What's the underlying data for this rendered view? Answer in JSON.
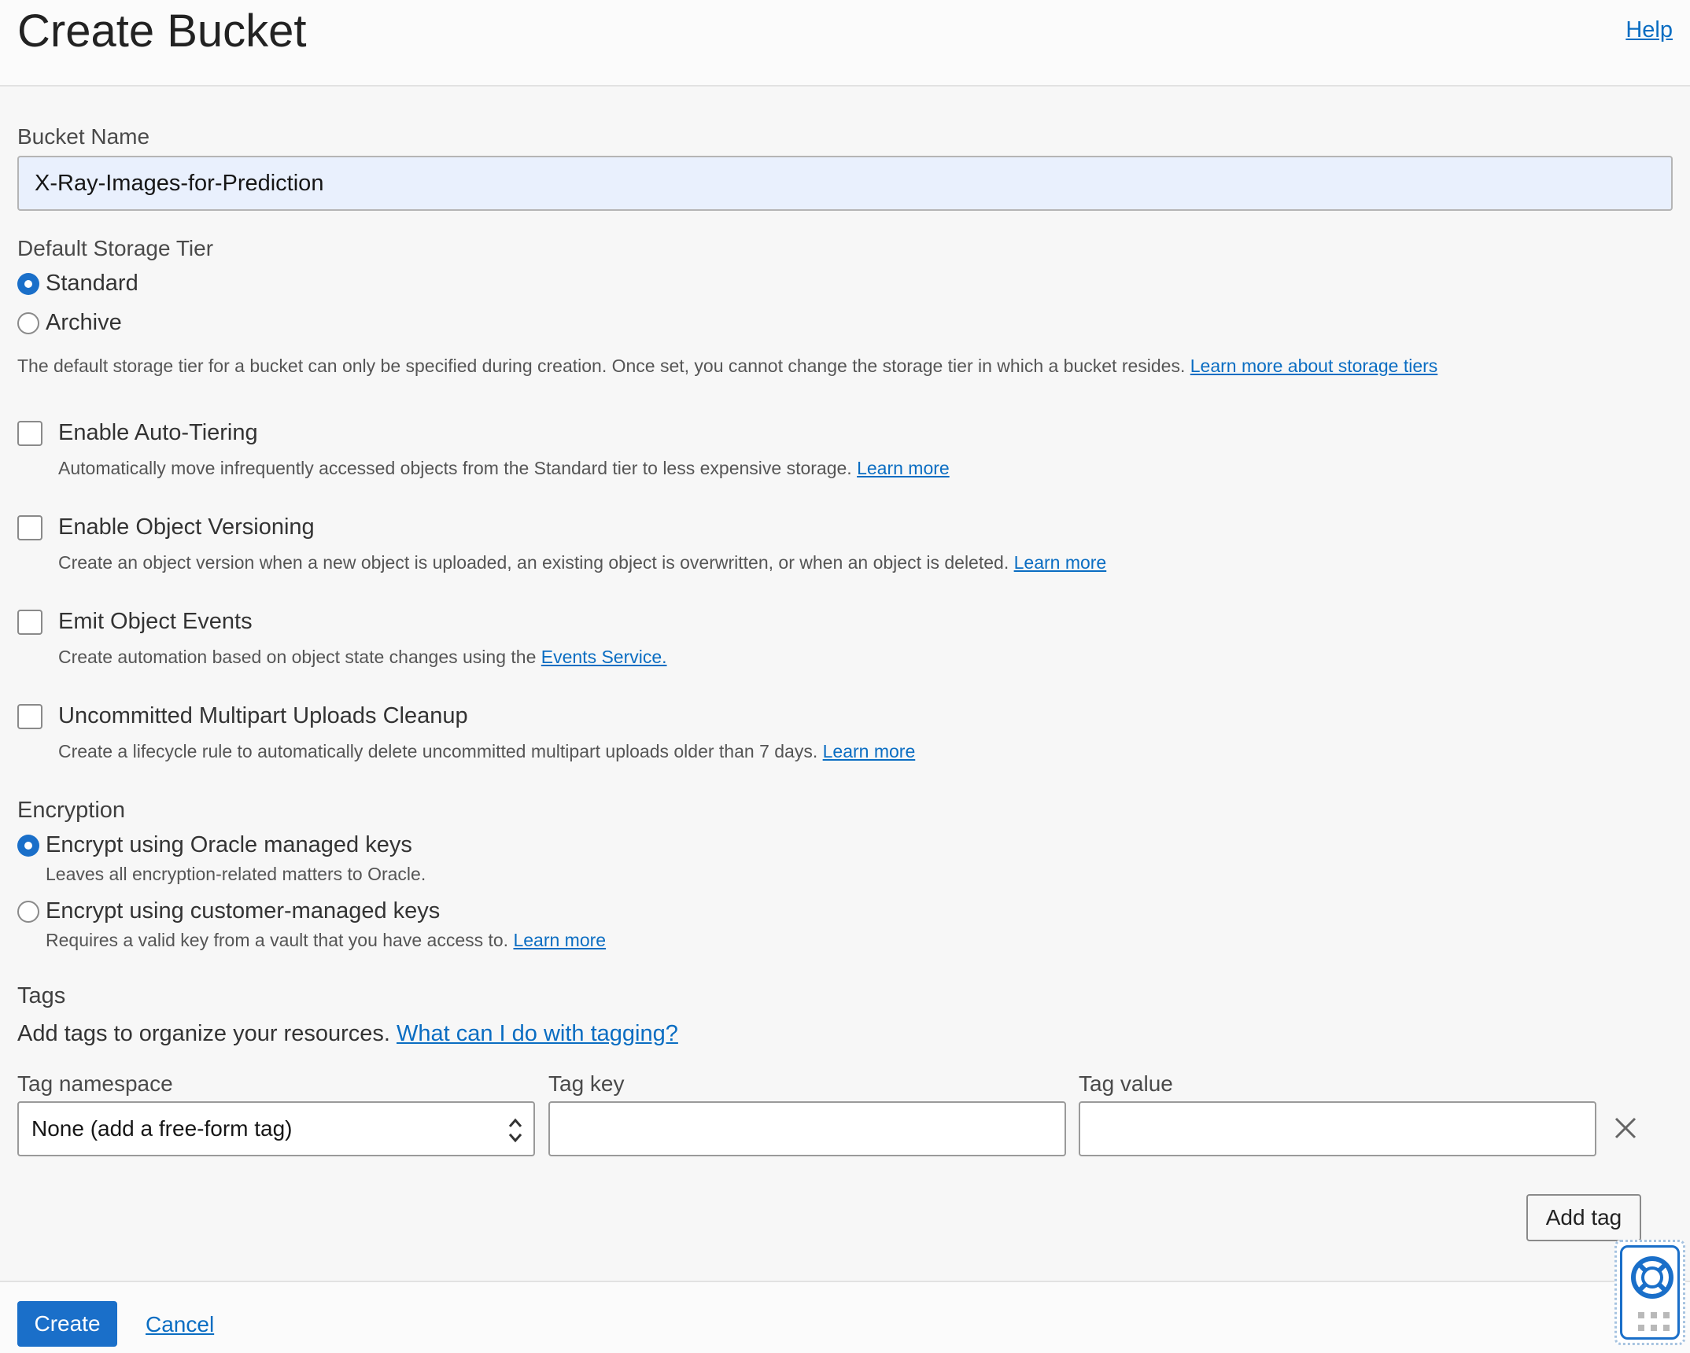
{
  "header": {
    "title": "Create Bucket",
    "help": "Help"
  },
  "bucket_name": {
    "label": "Bucket Name",
    "value": "X-Ray-Images-for-Prediction"
  },
  "storage_tier": {
    "label": "Default Storage Tier",
    "options": [
      {
        "label": "Standard",
        "checked": true
      },
      {
        "label": "Archive",
        "checked": false
      }
    ],
    "help": "The default storage tier for a bucket can only be specified during creation. Once set, you cannot change the storage tier in which a bucket resides.",
    "link": "Learn more about storage tiers"
  },
  "options": [
    {
      "label": "Enable Auto-Tiering",
      "checked": false,
      "help": "Automatically move infrequently accessed objects from the Standard tier to less expensive storage.",
      "link": "Learn more"
    },
    {
      "label": "Enable Object Versioning",
      "checked": false,
      "help": "Create an object version when a new object is uploaded, an existing object is overwritten, or when an object is deleted.",
      "link": "Learn more"
    },
    {
      "label": "Emit Object Events",
      "checked": false,
      "help": "Create automation based on object state changes using the",
      "link": "Events Service."
    },
    {
      "label": "Uncommitted Multipart Uploads Cleanup",
      "checked": false,
      "help": "Create a lifecycle rule to automatically delete uncommitted multipart uploads older than 7 days.",
      "link": "Learn more"
    }
  ],
  "encryption": {
    "label": "Encryption",
    "options": [
      {
        "label": "Encrypt using Oracle managed keys",
        "checked": true,
        "help": "Leaves all encryption-related matters to Oracle.",
        "link": ""
      },
      {
        "label": "Encrypt using customer-managed keys",
        "checked": false,
        "help": "Requires a valid key from a vault that you have access to.",
        "link": "Learn more"
      }
    ]
  },
  "tags": {
    "label": "Tags",
    "intro": "Add tags to organize your resources.",
    "intro_link": "What can I do with tagging?",
    "namespace_label": "Tag namespace",
    "namespace_value": "None (add a free-form tag)",
    "key_label": "Tag key",
    "key_value": "",
    "value_label": "Tag value",
    "value_value": "",
    "add_button": "Add tag"
  },
  "footer": {
    "create": "Create",
    "cancel": "Cancel"
  },
  "icons": {
    "remove": "close-icon",
    "support": "lifebuoy-icon",
    "grid": "grid-dots-icon"
  },
  "colors": {
    "accent": "#1a6fc9",
    "link": "#0a6dc2",
    "input_autofill": "#e9f0fd"
  }
}
